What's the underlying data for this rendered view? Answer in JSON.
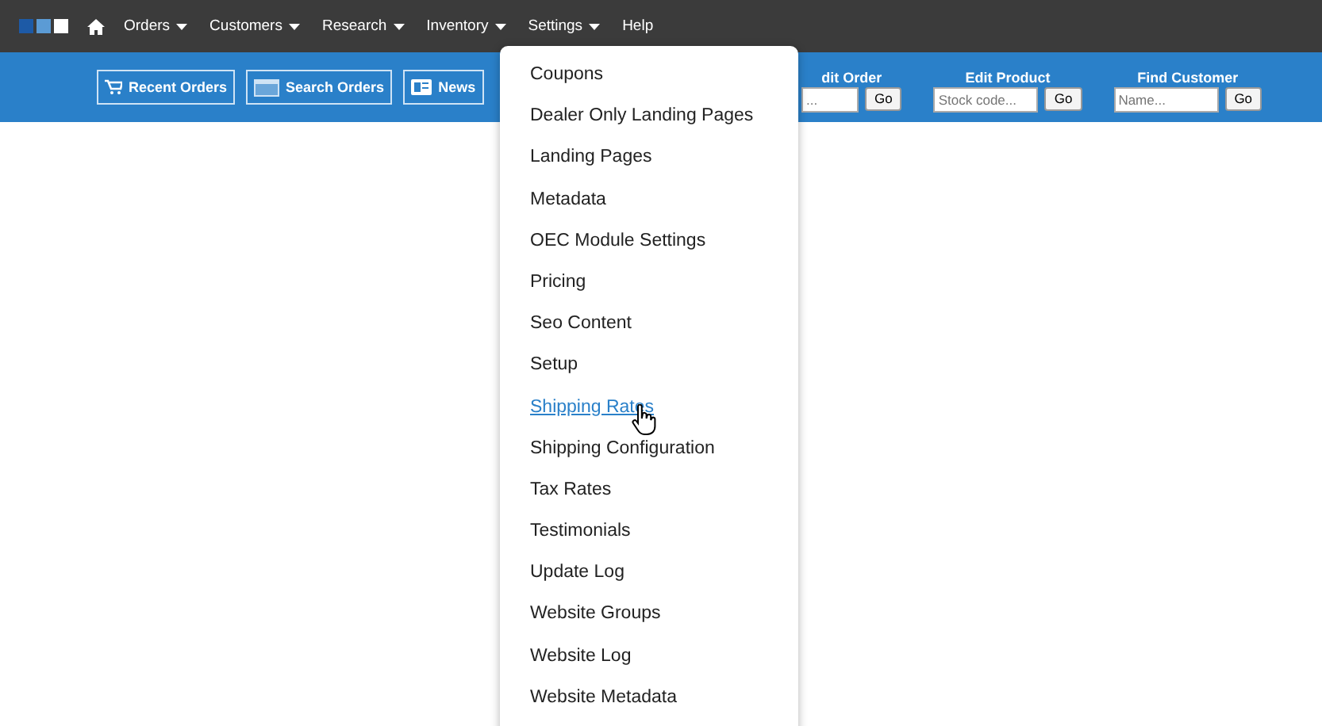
{
  "nav": [
    {
      "label": "Orders",
      "has_menu": true
    },
    {
      "label": "Customers",
      "has_menu": true
    },
    {
      "label": "Research",
      "has_menu": true
    },
    {
      "label": "Inventory",
      "has_menu": true
    },
    {
      "label": "Settings",
      "has_menu": true
    },
    {
      "label": "Help",
      "has_menu": false
    }
  ],
  "toolbar": {
    "buttons": [
      {
        "label": "Recent Orders",
        "kind": "cart"
      },
      {
        "label": "Search Orders",
        "kind": "window"
      },
      {
        "label": "News",
        "kind": "news"
      }
    ],
    "lookups": [
      {
        "label": "dit Order",
        "placeholder": "...",
        "button": "Go"
      },
      {
        "label": "Edit Product",
        "placeholder": "Stock code...",
        "button": "Go"
      },
      {
        "label": "Find Customer",
        "placeholder": "Name...",
        "button": "Go"
      }
    ]
  },
  "settings_menu": {
    "items": [
      {
        "label": "Coupons",
        "selected": false
      },
      {
        "label": "Dealer Only Landing Pages",
        "selected": false
      },
      {
        "label": "Landing Pages",
        "selected": false
      },
      {
        "label": "Metadata",
        "selected": false
      },
      {
        "label": "OEC Module Settings",
        "selected": false
      },
      {
        "label": "Pricing",
        "selected": false
      },
      {
        "label": "Seo Content",
        "selected": false
      },
      {
        "label": "Setup",
        "selected": false
      },
      {
        "label": "Shipping Rates",
        "selected": true
      },
      {
        "label": "Shipping Configuration",
        "selected": false
      },
      {
        "label": "Tax Rates",
        "selected": false
      },
      {
        "label": "Testimonials",
        "selected": false
      },
      {
        "label": "Update Log",
        "selected": false
      },
      {
        "label": "Website Groups",
        "selected": false
      },
      {
        "label": "Website Log",
        "selected": false
      },
      {
        "label": "Website Metadata",
        "selected": false
      }
    ]
  }
}
